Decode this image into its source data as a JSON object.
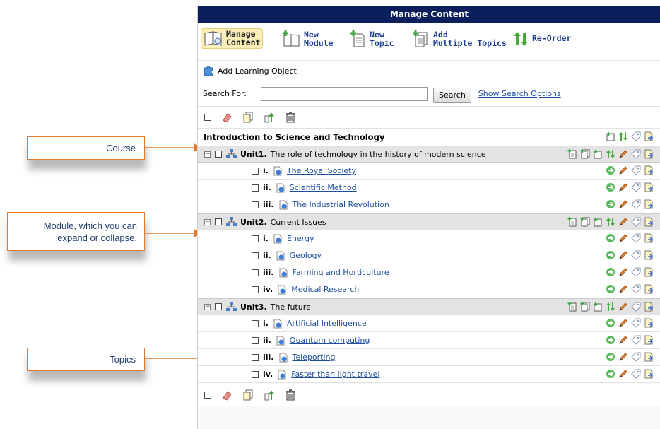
{
  "callouts": {
    "course": "Course",
    "module_line1": "Module, which you can",
    "module_line2": "expand or collapse.",
    "topics": "Topics"
  },
  "panel": {
    "title": "Manage Content",
    "toolbar": [
      {
        "line1": "Manage",
        "line2": "Content",
        "icon": "book-icon"
      },
      {
        "line1": "New",
        "line2": "Module",
        "icon": "new-module-icon"
      },
      {
        "line1": "New",
        "line2": "Topic",
        "icon": "new-topic-icon"
      },
      {
        "line1": "Add",
        "line2": "Multiple Topics",
        "icon": "multiple-topics-icon"
      },
      {
        "line1": "Re-Order",
        "icon": "reorder-icon"
      }
    ],
    "add_learning_object": "Add Learning Object",
    "search": {
      "label": "Search For:",
      "value": "",
      "button": "Search",
      "options_link": "Show Search Options"
    },
    "course_title": "Introduction to Science and Technology",
    "modules": [
      {
        "name": "Unit1.",
        "title": "The role of technology in the history of modern science",
        "topics": [
          {
            "num": "i.",
            "title": "The Royal Society"
          },
          {
            "num": "ii.",
            "title": "Scientific Method"
          },
          {
            "num": "iii.",
            "title": "The Industrial Revolution"
          }
        ]
      },
      {
        "name": "Unit2.",
        "title": "Current Issues",
        "topics": [
          {
            "num": "i.",
            "title": "Energy"
          },
          {
            "num": "ii.",
            "title": "Geology"
          },
          {
            "num": "iii.",
            "title": "Farming and Horticulture"
          },
          {
            "num": "iv.",
            "title": "Medical Research"
          }
        ]
      },
      {
        "name": "Unit3.",
        "title": "The future",
        "topics": [
          {
            "num": "i.",
            "title": "Artificial Intelligence"
          },
          {
            "num": "ii.",
            "title": "Quantum computing"
          },
          {
            "num": "iii.",
            "title": "Teleporting"
          },
          {
            "num": "iv.",
            "title": "Faster than light travel"
          }
        ]
      }
    ]
  },
  "colors": {
    "titlebar": "#0b1f5c",
    "callout_border": "#e07a2a",
    "callout_text": "#1e3f70",
    "link": "#1c4e9c"
  }
}
